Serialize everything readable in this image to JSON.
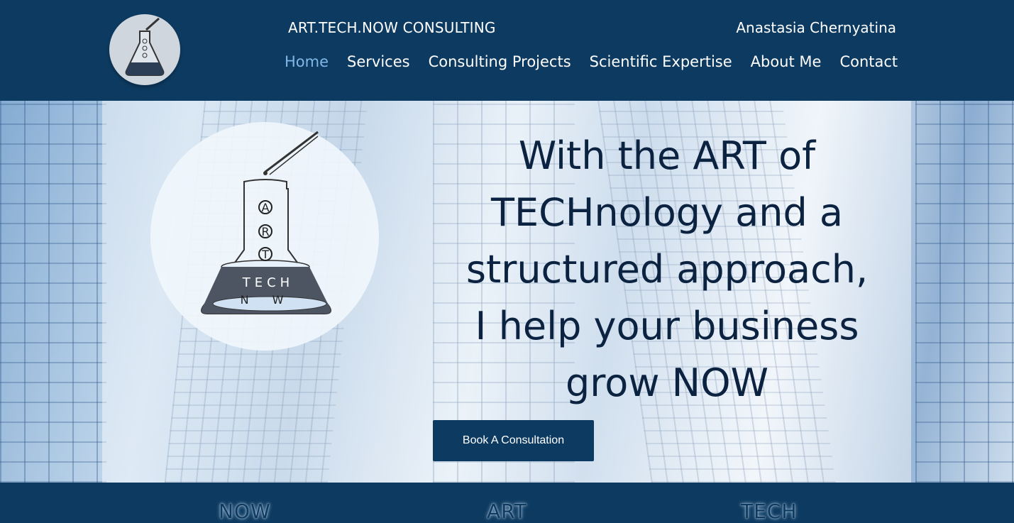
{
  "header": {
    "brand": "ART.TECH.NOW CONSULTING",
    "owner": "Anastasia Chernyatina",
    "logo_icon": "flask-logo-icon"
  },
  "nav": {
    "items": [
      {
        "label": "Home",
        "active": true
      },
      {
        "label": "Services"
      },
      {
        "label": "Consulting Projects"
      },
      {
        "label": "Scientific Expertise"
      },
      {
        "label": "About Me"
      },
      {
        "label": "Contact"
      }
    ]
  },
  "hero": {
    "headline": [
      "With the ART of",
      "TECHnology and a",
      "structured approach,",
      "I help your business",
      "grow NOW"
    ],
    "cta_label": "Book A Consultation",
    "logo": {
      "letters": [
        "A",
        "R",
        "T"
      ],
      "tech": "TECH",
      "now": "N W"
    }
  },
  "strip": {
    "pillars": [
      "NOW",
      "ART",
      "TECH"
    ]
  },
  "colors": {
    "header_bg": "#0d3a60",
    "nav_active": "#7fb8e8",
    "headline_text": "#0b2340"
  }
}
